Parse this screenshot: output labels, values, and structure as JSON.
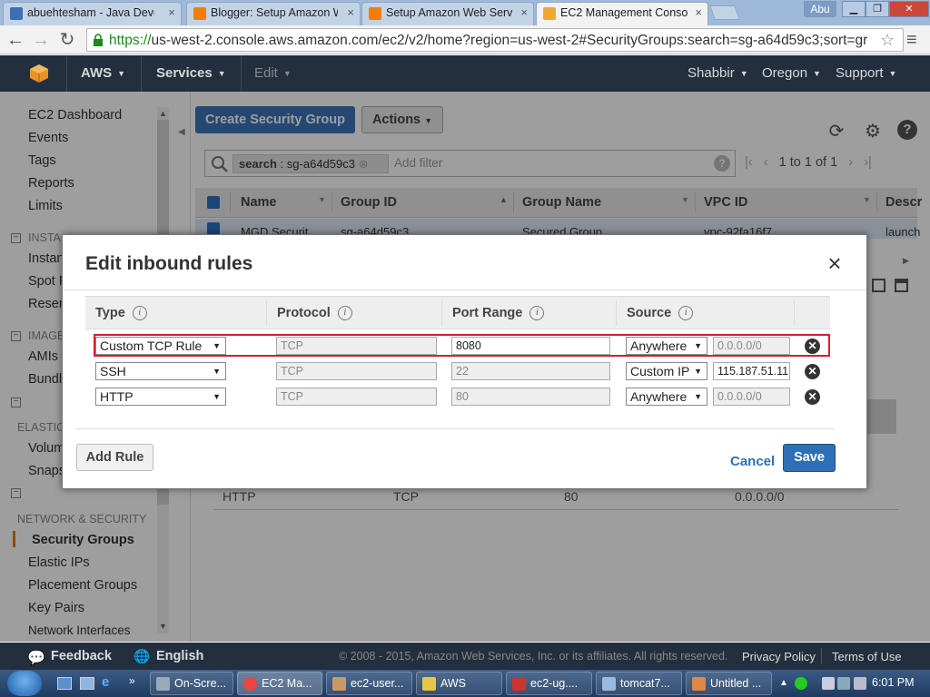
{
  "browser": {
    "tabs": [
      {
        "label": "abuehtesham - Java Devel",
        "favicon_color": "#3b6fb6"
      },
      {
        "label": "Blogger: Setup Amazon W",
        "favicon_color": "#f57d00"
      },
      {
        "label": "Setup Amazon Web Servic",
        "favicon_color": "#f57d00"
      },
      {
        "label": "EC2 Management Console",
        "favicon_color": "#f0a830"
      }
    ],
    "user_badge": "Abu",
    "url_scheme": "https://",
    "url_rest": "us-west-2.console.aws.amazon.com/ec2/v2/home?region=us-west-2#SecurityGroups:search=sg-a64d59c3;sort=gr"
  },
  "aws_header": {
    "brand": "AWS",
    "services": "Services",
    "edit": "Edit",
    "account": "Shabbir",
    "region": "Oregon",
    "support": "Support"
  },
  "sidebar": {
    "items": [
      {
        "label": "EC2 Dashboard"
      },
      {
        "label": "Events"
      },
      {
        "label": "Tags"
      },
      {
        "label": "Reports"
      },
      {
        "label": "Limits"
      }
    ],
    "section_instances": "INSTA",
    "instances_items": [
      "Instan",
      "Spot R",
      "Reser"
    ],
    "section_images": "IMAGE",
    "images_items": [
      "AMIs",
      "Bundl"
    ],
    "section_ebs": "ELASTIC",
    "ebs_items": [
      "Volum",
      "Snaps"
    ],
    "section_network": "NETWORK & SECURITY",
    "network_items": [
      "Security Groups",
      "Elastic IPs",
      "Placement Groups",
      "Key Pairs",
      "Network Interfaces"
    ]
  },
  "main": {
    "create_button": "Create Security Group",
    "actions_button": "Actions",
    "filter_key": "search",
    "filter_sep": ":",
    "filter_value": "sg-a64d59c3",
    "add_filter_placeholder": "Add filter",
    "pager_text": "1 to 1 of 1",
    "columns": [
      "Name",
      "Group ID",
      "Group Name",
      "VPC ID",
      "Descr"
    ],
    "row": {
      "name": "MGD Securit",
      "group_id": "sg-a64d59c3",
      "group_name": "Secured Group",
      "vpc": "vpc-92fa16f7",
      "desc": "launch"
    },
    "detail_row": {
      "type": "HTTP",
      "protocol": "TCP",
      "port": "80",
      "source": "0.0.0.0/0"
    }
  },
  "modal": {
    "title": "Edit inbound rules",
    "headers": {
      "type": "Type",
      "protocol": "Protocol",
      "port_range": "Port Range",
      "source": "Source"
    },
    "info_glyph": "i",
    "rules": [
      {
        "type": "Custom TCP Rule",
        "protocol": "TCP",
        "port": "8080",
        "source": "Anywhere",
        "cidr": "0.0.0.0/0"
      },
      {
        "type": "SSH",
        "protocol": "TCP",
        "port": "22",
        "source": "Custom IP",
        "cidr": "115.187.51.11"
      },
      {
        "type": "HTTP",
        "protocol": "TCP",
        "port": "80",
        "source": "Anywhere",
        "cidr": "0.0.0.0/0"
      }
    ],
    "add_rule": "Add Rule",
    "cancel": "Cancel",
    "save": "Save",
    "highlight_color": "#d2202f"
  },
  "footer": {
    "feedback": "Feedback",
    "language": "English",
    "copyright": "© 2008 - 2015, Amazon Web Services, Inc. or its affiliates. All rights reserved.",
    "privacy": "Privacy Policy",
    "terms": "Terms of Use"
  },
  "taskbar": {
    "items": [
      "On-Scre...",
      "EC2 Ma...",
      "ec2-user...",
      "AWS",
      "ec2-ug....",
      "tomcat7...",
      "Untitled ..."
    ],
    "clock": "6:01 PM"
  },
  "colors": {
    "accent": "#e07b1e",
    "primary_button": "#3b75b8",
    "header_bg": "#232f3e"
  }
}
